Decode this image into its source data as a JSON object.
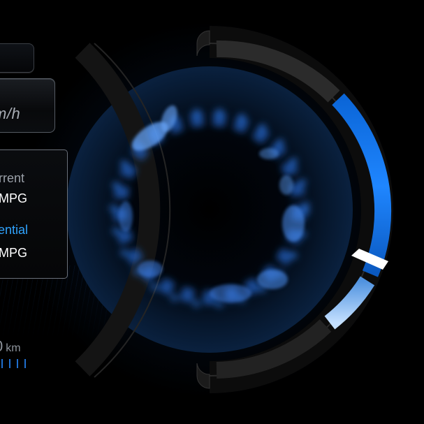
{
  "speed_panel": {
    "unit_text": "m/h"
  },
  "mpg_panel": {
    "current_label": "rrent",
    "current_value": "MPG",
    "potential_label": "tential",
    "potential_value": "MPG"
  },
  "odometer": {
    "value": "0",
    "unit": "km"
  },
  "gauge": {
    "fill_level": 0.62,
    "accent_color": "#1E7BFF",
    "light_accent": "#9CC8FF",
    "ring_color": "#1A1A1A"
  }
}
